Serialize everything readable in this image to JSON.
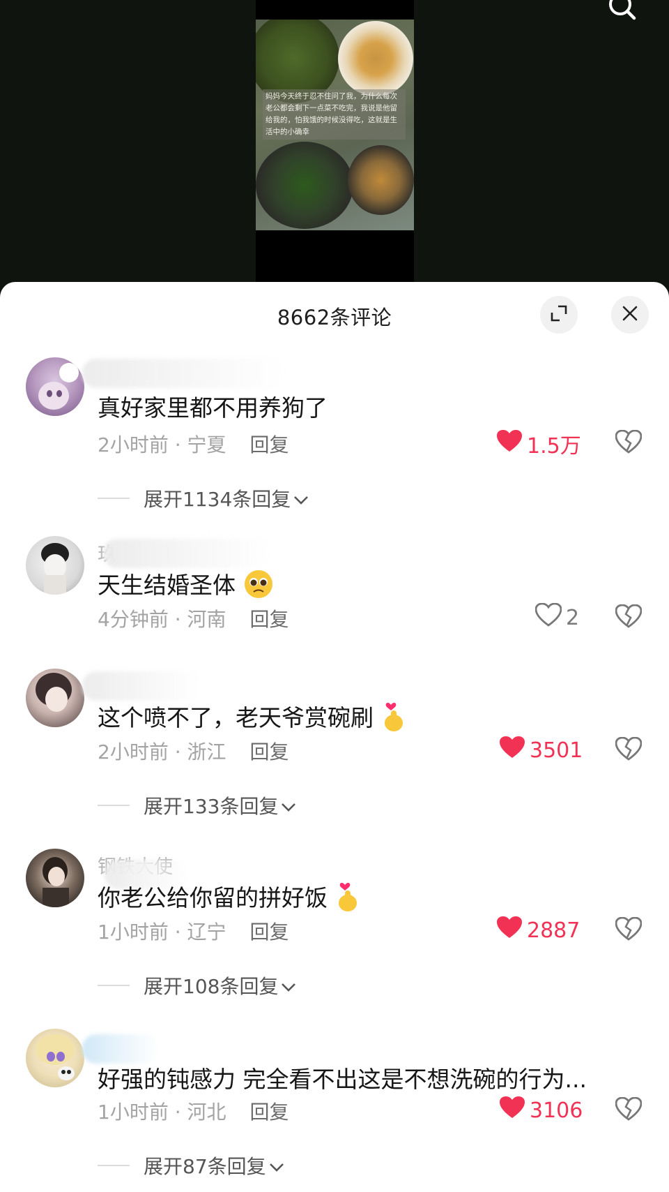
{
  "video": {
    "caption": "妈妈今天终于忍不住问了我，为什么每次老公都会剩下一点菜不吃完，我说是他留给我的，怕我饿的时候没得吃，这就是生活中的小确幸"
  },
  "sheet": {
    "title": "8662条评论"
  },
  "comments": [
    {
      "name_fragment": "",
      "text": "真好家里都不用养狗了",
      "time": "2小时前",
      "location": "宁夏",
      "reply_label": "回复",
      "likes": "1.5万",
      "liked": true,
      "expand": "展开1134条回复"
    },
    {
      "name_fragment": "玖",
      "text": "天生结婚圣体",
      "emoji": "pleading-face",
      "time": "4分钟前",
      "location": "河南",
      "reply_label": "回复",
      "likes": "2",
      "liked": false,
      "expand": ""
    },
    {
      "name_fragment": "",
      "text": "这个喷不了，老天爷赏碗刷",
      "emoji": "finger-heart",
      "time": "2小时前",
      "location": "浙江",
      "reply_label": "回复",
      "likes": "3501",
      "liked": true,
      "expand": "展开133条回复"
    },
    {
      "name_fragment": "钢铁大使",
      "text": "你老公给你留的拼好饭",
      "emoji": "finger-heart",
      "time": "1小时前",
      "location": "辽宁",
      "reply_label": "回复",
      "likes": "2887",
      "liked": true,
      "expand": "展开108条回复"
    },
    {
      "name_fragment": "",
      "text": "好强的钝感力 完全看不出这是不想洗碗的行为...",
      "time": "1小时前",
      "location": "河北",
      "reply_label": "回复",
      "likes": "3106",
      "liked": true,
      "expand": "展开87条回复"
    }
  ],
  "colors": {
    "like_red": "#f23254",
    "meta_gray": "#a3a3a3",
    "sheet_bg": "#ffffff",
    "video_bg": "#10140f"
  },
  "icons": {
    "search": "search-icon",
    "expand": "expand-icon",
    "close": "close-icon",
    "like": "heart-icon",
    "dislike": "broken-heart-icon",
    "chevron": "chevron-down-icon"
  }
}
